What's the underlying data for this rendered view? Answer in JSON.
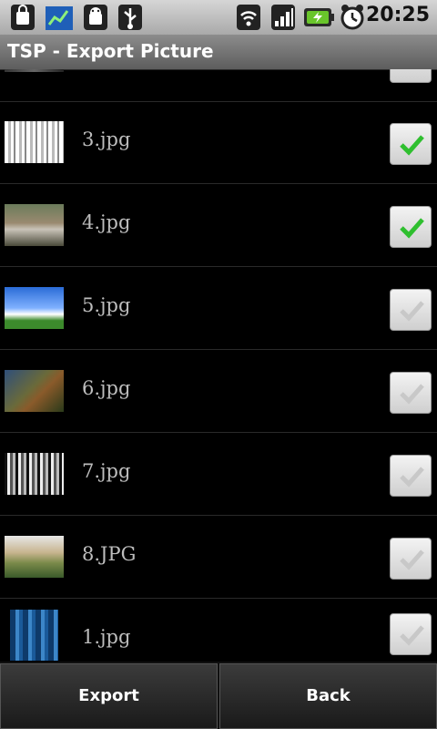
{
  "status_bar": {
    "time": "20:25",
    "icons": [
      "shopping-bag-icon",
      "stock-chart-icon",
      "android-debug-icon",
      "usb-icon",
      "wifi-icon",
      "signal-icon",
      "battery-charging-icon",
      "alarm-clock-icon"
    ]
  },
  "title_bar": {
    "title": "TSP - Export Picture"
  },
  "list": {
    "items": [
      {
        "label": "",
        "checked": false
      },
      {
        "label": "3.jpg",
        "checked": true
      },
      {
        "label": "4.jpg",
        "checked": true
      },
      {
        "label": "5.jpg",
        "checked": false
      },
      {
        "label": "6.jpg",
        "checked": false
      },
      {
        "label": "7.jpg",
        "checked": false
      },
      {
        "label": "8.JPG",
        "checked": false
      },
      {
        "label": "1.jpg",
        "checked": false
      }
    ]
  },
  "buttons": {
    "export_label": "Export",
    "back_label": "Back"
  },
  "colors": {
    "check_on": "#2fbf2f",
    "check_off": "#c8c8c8"
  }
}
